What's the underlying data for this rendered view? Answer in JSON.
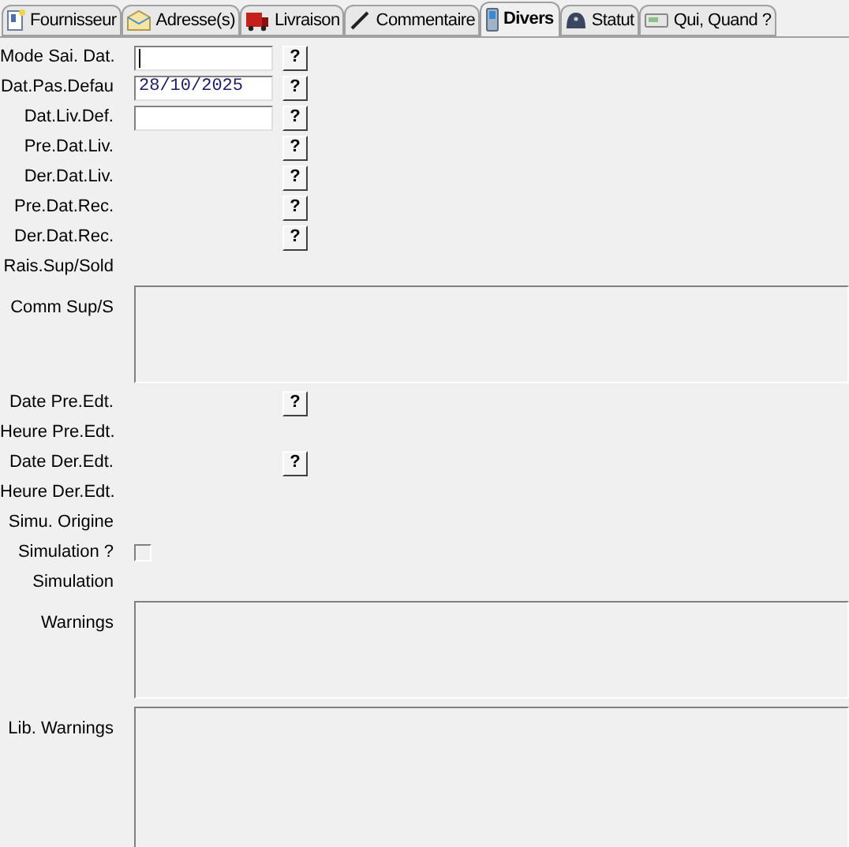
{
  "tabs": [
    {
      "label": "Fournisseur",
      "selected": false
    },
    {
      "label": "Adresse(s)",
      "selected": false
    },
    {
      "label": "Livraison",
      "selected": false
    },
    {
      "label": "Commentaire",
      "selected": false
    },
    {
      "label": "Divers",
      "selected": true
    },
    {
      "label": "Statut",
      "selected": false
    },
    {
      "label": "Qui, Quand ?",
      "selected": false
    }
  ],
  "fields": [
    {
      "label": "Mode Sai. Dat.",
      "kind": "input",
      "focused": true,
      "help": "?"
    },
    {
      "label": "Dat.Pas.Defau",
      "kind": "input",
      "value": "28/10/2025",
      "focused": false,
      "help": "?"
    },
    {
      "label": "Dat.Liv.Def.",
      "kind": "input",
      "focused": false,
      "help": "?"
    },
    {
      "label": "Pre.Dat.Liv.",
      "kind": "help",
      "help": "?"
    },
    {
      "label": "Der.Dat.Liv.",
      "kind": "help",
      "help": "?"
    },
    {
      "label": "Pre.Dat.Rec.",
      "kind": "help",
      "help": "?"
    },
    {
      "label": "Der.Dat.Rec.",
      "kind": "help",
      "help": "?"
    },
    {
      "label": "Rais.Sup/Sold",
      "kind": "label"
    },
    {
      "label": "Comm Sup/S",
      "kind": "memo"
    },
    {
      "label": "Date Pre.Edt.",
      "kind": "help",
      "help": "?"
    },
    {
      "label": "Heure Pre.Edt.",
      "kind": "label"
    },
    {
      "label": "Date Der.Edt.",
      "kind": "help",
      "help": "?"
    },
    {
      "label": "Heure Der.Edt.",
      "kind": "label"
    },
    {
      "label": "Simu. Origine",
      "kind": "label"
    },
    {
      "label": "Simulation ?",
      "kind": "checkbox",
      "checked": false
    },
    {
      "label": "Simulation",
      "kind": "label"
    },
    {
      "label": "Warnings",
      "kind": "memo"
    },
    {
      "label": "Lib. Warnings",
      "kind": "bigmemo"
    }
  ]
}
